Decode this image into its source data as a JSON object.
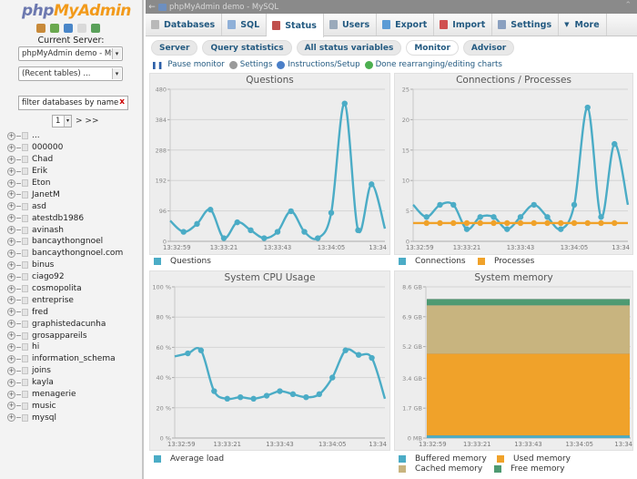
{
  "sidebar": {
    "logo_php": "php",
    "logo_myadmin": "MyAdmin",
    "icons": [
      {
        "name": "home-icon",
        "color": "#c88a3a"
      },
      {
        "name": "logout-icon",
        "color": "#6aa84f"
      },
      {
        "name": "help-icon",
        "color": "#4a86c8"
      },
      {
        "name": "docs-icon",
        "color": "#d9d9d9"
      },
      {
        "name": "reload-icon",
        "color": "#5aa05a"
      }
    ],
    "current_server_label": "Current Server:",
    "server_select": "phpMyAdmin demo - My",
    "recent_select": "(Recent tables) ...",
    "filter_placeholder": "filter databases by name",
    "filter_clear": "x",
    "page_value": "1",
    "page_next": "> >>",
    "databases": [
      "...",
      "000000",
      "Chad",
      "Erik",
      "Eton",
      "JanetM",
      "asd",
      "atestdb1986",
      "avinash",
      "bancaythongnoel",
      "bancaythongnoel.com",
      "binus",
      "ciago92",
      "cosmopolita",
      "entreprise",
      "fred",
      "graphistedacunha",
      "grosappareils",
      "hi",
      "information_schema",
      "joins",
      "kayla",
      "menagerie",
      "music",
      "mysql"
    ]
  },
  "titlebar": {
    "back": "←",
    "title": "phpMyAdmin demo - MySQL",
    "collapse": "⌃"
  },
  "tabs": [
    {
      "label": "Databases",
      "icon": "databases-icon",
      "color": "#b9b9b9",
      "active": false
    },
    {
      "label": "SQL",
      "icon": "sql-icon",
      "color": "#8fb0d8",
      "active": false
    },
    {
      "label": "Status",
      "icon": "status-icon",
      "color": "#c0504d",
      "active": true
    },
    {
      "label": "Users",
      "icon": "users-icon",
      "color": "#9aaabb",
      "active": false
    },
    {
      "label": "Export",
      "icon": "export-icon",
      "color": "#5b9bd5",
      "active": false
    },
    {
      "label": "Import",
      "icon": "import-icon",
      "color": "#d05050",
      "active": false
    },
    {
      "label": "Settings",
      "icon": "settings-icon",
      "color": "#8aa0c0",
      "active": false
    },
    {
      "label": "More",
      "icon": "more-caret-icon",
      "color": "#235a81",
      "active": false
    }
  ],
  "subtabs": [
    {
      "label": "Server",
      "active": false
    },
    {
      "label": "Query statistics",
      "active": false
    },
    {
      "label": "All status variables",
      "active": false
    },
    {
      "label": "Monitor",
      "active": true
    },
    {
      "label": "Advisor",
      "active": false
    }
  ],
  "actions": [
    {
      "label": "Pause monitor",
      "icon": "pause-icon",
      "color": "#2c5fa8"
    },
    {
      "label": "Settings",
      "icon": "gear-icon",
      "color": "#9a9a9a"
    },
    {
      "label": "Instructions/Setup",
      "icon": "info-icon",
      "color": "#4a7fc8"
    },
    {
      "label": "Done rearranging/editing charts",
      "icon": "check-icon",
      "color": "#4caf50"
    }
  ],
  "colors": {
    "teal": "#4bacc6",
    "orange": "#f0a22a",
    "tan": "#c8b47f",
    "green": "#4e9a72",
    "link": "#235a81"
  },
  "chart_data": [
    {
      "type": "line",
      "title": "Questions",
      "x": [
        "13:32:59",
        "",
        "",
        "",
        "",
        "13:33:21",
        "",
        "",
        "",
        "",
        "13:33:43",
        "",
        "",
        "",
        "",
        "13:34:05",
        "",
        "",
        "",
        "13:34"
      ],
      "xticks": [
        "13:32:59",
        "13:33:21",
        "13:33:43",
        "13:34:05",
        "13:34"
      ],
      "yticks": [
        "0",
        "96",
        "384",
        "288",
        "192",
        "480"
      ],
      "ylim": [
        0,
        480
      ],
      "ytick_values": [
        0,
        96,
        192,
        288,
        384,
        480
      ],
      "ytick_labels": [
        "0",
        "96",
        "192",
        "288",
        "384",
        "480"
      ],
      "series": [
        {
          "name": "Questions",
          "color": "#4bacc6",
          "values": [
            65,
            30,
            55,
            100,
            10,
            60,
            35,
            10,
            30,
            95,
            30,
            10,
            90,
            435,
            35,
            180,
            40
          ]
        }
      ]
    },
    {
      "type": "line",
      "title": "Connections / Processes",
      "ylim": [
        0,
        25
      ],
      "ytick_values": [
        0,
        5,
        10,
        15,
        20,
        25
      ],
      "ytick_labels": [
        "0",
        "5",
        "10",
        "15",
        "20",
        "25"
      ],
      "xticks": [
        "13:32:59",
        "13:33:21",
        "13:33:43",
        "13:34:05",
        "13:34"
      ],
      "series": [
        {
          "name": "Connections",
          "color": "#4bacc6",
          "values": [
            6,
            4,
            6,
            6,
            2,
            4,
            4,
            2,
            4,
            6,
            4,
            2,
            6,
            22,
            4,
            16,
            6
          ]
        },
        {
          "name": "Processes",
          "color": "#f0a22a",
          "values": [
            3,
            3,
            3,
            3,
            3,
            3,
            3,
            3,
            3,
            3,
            3,
            3,
            3,
            3,
            3,
            3,
            3
          ]
        }
      ]
    },
    {
      "type": "line",
      "title": "System CPU Usage",
      "ylim": [
        0,
        100
      ],
      "ytick_values": [
        0,
        20,
        40,
        60,
        80,
        100
      ],
      "ytick_labels": [
        "0 %",
        "20 %",
        "40 %",
        "60 %",
        "80 %",
        "100 %"
      ],
      "xticks": [
        "13:32:59",
        "13:33:21",
        "13:33:43",
        "13:34:05",
        "13:34"
      ],
      "series": [
        {
          "name": "Average load",
          "color": "#4bacc6",
          "values": [
            54,
            56,
            58,
            31,
            26,
            27,
            26,
            28,
            31,
            29,
            27,
            29,
            40,
            58,
            55,
            53,
            26
          ]
        }
      ]
    },
    {
      "type": "area",
      "stacked": true,
      "title": "System memory",
      "ylim": [
        0,
        8.6
      ],
      "unit": "GB",
      "ytick_values": [
        0,
        1.7,
        3.4,
        5.2,
        6.9,
        8.6
      ],
      "ytick_labels": [
        "0 MB",
        "1.7 GB",
        "3.4 GB",
        "5.2 GB",
        "6.9 GB",
        "8.6 GB"
      ],
      "xticks": [
        "13:32:59",
        "13:33:21",
        "13:33:43",
        "13:34:05",
        "13:34"
      ],
      "series": [
        {
          "name": "Buffered memory",
          "color": "#4bacc6",
          "value": 0.15
        },
        {
          "name": "Used memory",
          "color": "#f0a22a",
          "value": 4.65
        },
        {
          "name": "Cached memory",
          "color": "#c8b47f",
          "value": 2.75
        },
        {
          "name": "Free memory",
          "color": "#4e9a72",
          "value": 0.35
        }
      ]
    }
  ]
}
